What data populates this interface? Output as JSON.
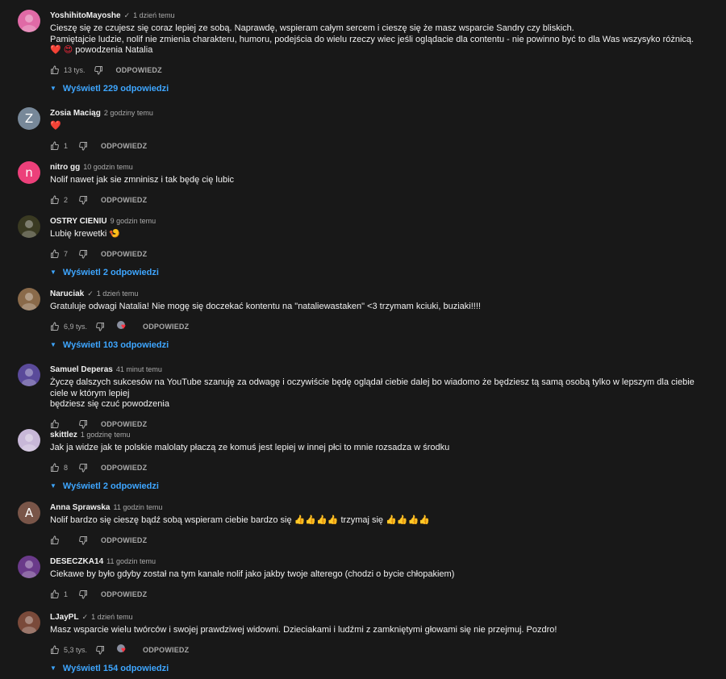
{
  "reply_label": "ODPOWIEDZ",
  "comments": [
    {
      "author": "YoshihitoMayoshe",
      "verified": "✓",
      "time": "1 dzień temu",
      "lines": [
        "Cieszę się ze czujesz się coraz lepiej ze sobą. Naprawdę, wspieram całym sercem i cieszę się że masz wsparcie Sandry czy bliskich.",
        "Pamiętajcie ludzie, nolif nie zmienia charakteru, humoru, podejścia do wielu rzeczy wiec jeśli oglądacie dla contentu - nie powinno być to dla Was wszysyko różnicą.",
        "powodzenia Natalia"
      ],
      "emoji_prefix": "❤️ 😍",
      "likes": "13 tys.",
      "replies": "Wyświetl 229 odpowiedzi",
      "avatar": {
        "kind": "image",
        "color": "#e06aa6"
      }
    },
    {
      "author": "Zosia Maciąg",
      "time": "2 godziny temu",
      "text": "❤️",
      "likes": "1",
      "avatar": {
        "kind": "letter",
        "letter": "Z",
        "color": "#778899"
      }
    },
    {
      "author": "nitro gg",
      "time": "10 godzin temu",
      "text": "Nolif nawet jak sie zmninisz i tak będę cię lubic",
      "likes": "2",
      "avatar": {
        "kind": "letter",
        "letter": "n",
        "color": "#ec407a"
      }
    },
    {
      "author": "OSTRY CIENIU",
      "time": "9 godzin temu",
      "text": "Lubię krewetki 🍤",
      "likes": "7",
      "replies": "Wyświetl 2 odpowiedzi",
      "avatar": {
        "kind": "image",
        "color": "#3a3a22"
      }
    },
    {
      "author": "Naruciak",
      "verified": "✓",
      "time": "1 dzień temu",
      "text": "Gratuluje odwagi Natalia! Nie mogę się doczekać kontentu na \"nataliewastaken\" <3 trzymam kciuki, buziaki!!!!",
      "likes": "6,9 tys.",
      "hearted": true,
      "replies": "Wyświetl 103 odpowiedzi",
      "avatar": {
        "kind": "image",
        "color": "#8a6a4a"
      }
    },
    {
      "author": "Samuel Deperas",
      "time": "41 minut temu",
      "lines": [
        "Życzę dalszych sukcesów na YouTube szanuję za odwagę i oczywiście będę oglądał ciebie dalej bo wiadomo że będziesz tą samą osobą tylko w lepszym dla ciebie ciele w którym lepiej",
        "będziesz się czuć powodzenia"
      ],
      "likes": "",
      "avatar": {
        "kind": "image",
        "color": "#5a4a9a"
      }
    },
    {
      "author": "skittlez",
      "time": "1 godzinę temu",
      "text": "Jak ja widze jak te polskie malolaty płaczą ze komuś jest lepiej w innej płci to mnie rozsadza w środku",
      "likes": "8",
      "replies": "Wyświetl 2 odpowiedzi",
      "avatar": {
        "kind": "image",
        "color": "#c8b8d8"
      }
    },
    {
      "author": "Anna Sprawska",
      "time": "11 godzin temu",
      "text": "Nolif bardzo się cieszę bądź sobą wspieram ciebie bardzo  się 👍👍👍👍 trzymaj się 👍👍👍👍",
      "likes": "",
      "avatar": {
        "kind": "letter",
        "letter": "A",
        "color": "#795548"
      }
    },
    {
      "author": "DESECZKA14",
      "time": "11 godzin temu",
      "text": "Ciekawe by było gdyby został na tym kanale nolif jako jakby twoje alterego (chodzi o bycie chłopakiem)",
      "likes": "1",
      "avatar": {
        "kind": "image",
        "color": "#6a3a8a"
      }
    },
    {
      "author": "LJayPL",
      "verified": "✓",
      "time": "1 dzień temu",
      "text": "Masz wsparcie wielu twórców i swojej prawdziwej widowni. Dzieciakami i ludźmi z zamkniętymi głowami się nie przejmuj. Pozdro!",
      "likes": "5,3 tys.",
      "hearted": true,
      "replies": "Wyświetl 154 odpowiedzi",
      "avatar": {
        "kind": "image",
        "color": "#7a4a3a"
      }
    }
  ]
}
